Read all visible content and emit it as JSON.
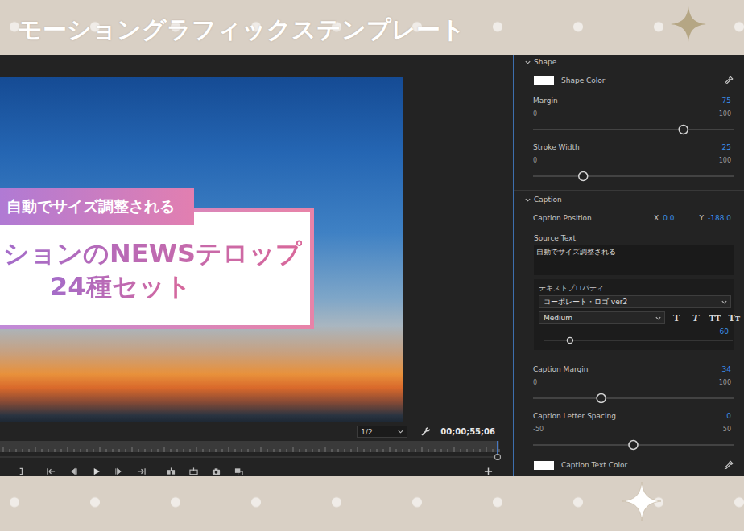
{
  "banner": {
    "title": "モーショングラフィックステンプレート"
  },
  "monitor": {
    "telop": {
      "label": "自動でサイズ調整される",
      "lines": [
        "ションのNEWSテロップ",
        "24種セット"
      ]
    },
    "zoom": "1/2",
    "timecode": "00;00;55;06",
    "playhead": {
      "level": 1.0
    }
  },
  "panel": {
    "sections": [
      {
        "title": "Shape",
        "expanded": true,
        "rows": [
          {
            "kind": "color",
            "label": "Shape Color",
            "color": "#ffffff"
          },
          {
            "kind": "slider",
            "label": "Margin",
            "value": "75",
            "min": "0",
            "max": "100",
            "level": 0.75
          },
          {
            "kind": "slider",
            "label": "Stroke Width",
            "value": "25",
            "min": "0",
            "max": "100",
            "level": 0.25
          }
        ]
      },
      {
        "title": "Caption",
        "expanded": true,
        "rows": [
          {
            "kind": "position",
            "label": "Caption Position",
            "x_label": "X",
            "x": "0.0",
            "y_label": "Y",
            "y": "-188.0"
          },
          {
            "kind": "text",
            "label": "Source Text",
            "value": "自動でサイズ調整される"
          },
          {
            "kind": "textprops",
            "label": "テキストプロパティ",
            "font": "コーポレート・ロゴ ver2",
            "style": "Medium",
            "style_buttons": [
              {
                "label": "T",
                "kind": "bold",
                "selected": false
              },
              {
                "label": "T",
                "kind": "italic",
                "selected": false
              },
              {
                "label": "TT",
                "kind": "caps",
                "selected": false
              },
              {
                "label": "Tт",
                "kind": "smallcaps",
                "selected": false
              }
            ],
            "size": "60",
            "level": 0.14
          },
          {
            "kind": "slider",
            "label": "Caption Margin",
            "value": "34",
            "min": "0",
            "max": "100",
            "level": 0.34
          },
          {
            "kind": "slider",
            "label": "Caption Letter Spacing",
            "value": "0",
            "min": "-50",
            "max": "50",
            "level": 0.5
          },
          {
            "kind": "color",
            "label": "Caption Text Color",
            "color": "#ffffff"
          }
        ]
      }
    ]
  }
}
